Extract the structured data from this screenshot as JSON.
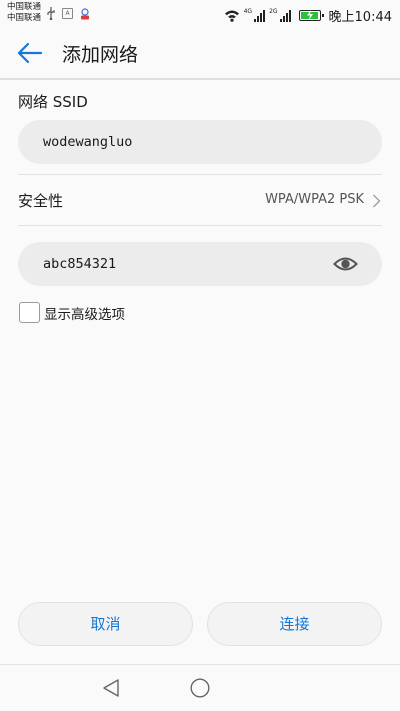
{
  "status_bar": {
    "carrier_1": "中国联通",
    "carrier_2": "中国联通",
    "network_1": "4G",
    "network_2": "2G",
    "time": "晚上10:44",
    "icons": [
      "usb-icon",
      "sim-icon",
      "app-icon",
      "wifi-icon",
      "signal-icon",
      "signal-icon",
      "battery-charging-icon"
    ],
    "battery_color": "#2bbf3a"
  },
  "header": {
    "title": "添加网络",
    "back_icon": "arrow-left-icon",
    "accent": "#1677d9"
  },
  "form": {
    "ssid_label": "网络 SSID",
    "ssid_value": "wodewangluo",
    "security_label": "安全性",
    "security_value": "WPA/WPA2 PSK",
    "password_value": "abc854321",
    "advanced_label": "显示高级选项",
    "advanced_checked": false
  },
  "buttons": {
    "cancel": "取消",
    "connect": "连接"
  },
  "nav_bar": {
    "icons": [
      "nav-back-icon",
      "nav-home-icon"
    ]
  }
}
